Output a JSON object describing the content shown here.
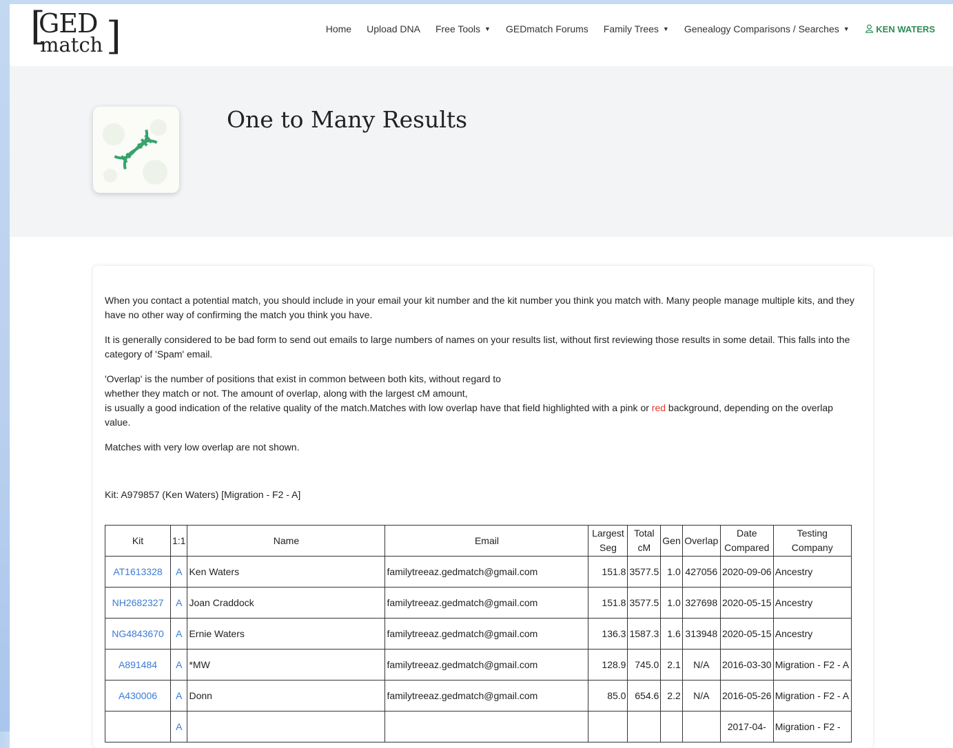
{
  "logo": {
    "line1": "GED",
    "line2": "match"
  },
  "nav": {
    "items": [
      "Home",
      "Upload DNA",
      "Free Tools",
      "GEDmatch Forums",
      "Family Trees",
      "Genealogy Comparisons / Searches"
    ],
    "user": "KEN WATERS"
  },
  "hero": {
    "title": "One to Many Results"
  },
  "intro": {
    "p1": "When you contact a potential match, you should include in your email your kit number and the kit number you think you match with. Many people manage multiple kits, and they have no other way of confirming the match you think you have.",
    "p2": "It is generally considered to be bad form to send out emails to large numbers of names on your results list, without first reviewing those results in some detail. This falls into the category of 'Spam' email.",
    "p3a": "'Overlap' is the number of positions that exist in common between both kits, without regard to",
    "p3b": "whether they match or not. The amount of overlap, along with the largest cM amount,",
    "p3c": "is usually a good indication of the relative quality of the match.Matches with low overlap have that field highlighted with a pink or ",
    "p3red": "red",
    "p3d": " background, depending on the overlap value.",
    "p4": "Matches with very low overlap are not shown.",
    "kit": "Kit: A979857 (Ken Waters) [Migration - F2 - A]"
  },
  "table": {
    "headers": [
      "Kit",
      "1:1",
      "Name",
      "Email",
      "Largest Seg",
      "Total cM",
      "Gen",
      "Overlap",
      "Date Compared",
      "Testing Company"
    ],
    "rows": [
      {
        "kit": "AT1613328",
        "one": "A",
        "name": "Ken Waters",
        "email": "familytreeaz.gedmatch@gmail.com",
        "seg": "151.8",
        "total": "3577.5",
        "gen": "1.0",
        "overlap": "427056",
        "date": "2020-09-06",
        "company": "Ancestry"
      },
      {
        "kit": "NH2682327",
        "one": "A",
        "name": "Joan Craddock",
        "email": "familytreeaz.gedmatch@gmail.com",
        "seg": "151.8",
        "total": "3577.5",
        "gen": "1.0",
        "overlap": "327698",
        "date": "2020-05-15",
        "company": "Ancestry"
      },
      {
        "kit": "NG4843670",
        "one": "A",
        "name": "Ernie Waters",
        "email": "familytreeaz.gedmatch@gmail.com",
        "seg": "136.3",
        "total": "1587.3",
        "gen": "1.6",
        "overlap": "313948",
        "date": "2020-05-15",
        "company": "Ancestry"
      },
      {
        "kit": "A891484",
        "one": "A",
        "name": "*MW",
        "email": "familytreeaz.gedmatch@gmail.com",
        "seg": "128.9",
        "total": "745.0",
        "gen": "2.1",
        "overlap": "N/A",
        "date": "2016-03-30",
        "company": "Migration - F2 - A"
      },
      {
        "kit": "A430006",
        "one": "A",
        "name": "Donn",
        "email": "familytreeaz.gedmatch@gmail.com",
        "seg": "85.0",
        "total": "654.6",
        "gen": "2.2",
        "overlap": "N/A",
        "date": "2016-05-26",
        "company": "Migration - F2 - A"
      },
      {
        "kit": "",
        "one": "A",
        "name": "",
        "email": "",
        "seg": "",
        "total": "",
        "gen": "",
        "overlap": "",
        "date": "2017-04-",
        "company": "Migration - F2 -"
      }
    ]
  }
}
